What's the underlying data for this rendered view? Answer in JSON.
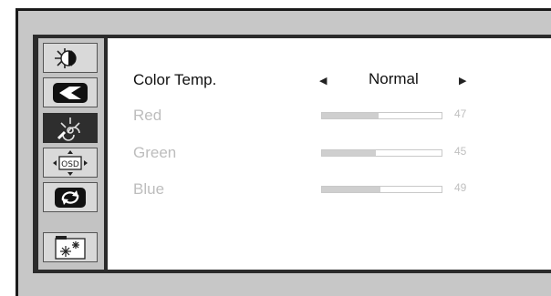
{
  "menu": {
    "icons": [
      {
        "name": "brightness-contrast-icon",
        "selected": false
      },
      {
        "name": "image-setup-icon",
        "selected": false
      },
      {
        "name": "color-settings-icon",
        "selected": true
      },
      {
        "name": "osd-settings-icon",
        "selected": false
      },
      {
        "name": "reset-icon",
        "selected": false
      },
      {
        "name": "misc-settings-icon",
        "selected": false
      }
    ],
    "osd_icon_text": "OSD"
  },
  "settings": {
    "color_temp": {
      "label": "Color Temp.",
      "value": "Normal"
    },
    "channels": [
      {
        "label": "Red",
        "value": "47",
        "level": 0.47
      },
      {
        "label": "Green",
        "value": "45",
        "level": 0.45
      },
      {
        "label": "Blue",
        "value": "49",
        "level": 0.49
      }
    ]
  },
  "colors": {
    "selected_icon_bg": "#2e2e2e",
    "disabled_text": "#bdbdbd",
    "bar_fill": "#cfcfcf"
  }
}
